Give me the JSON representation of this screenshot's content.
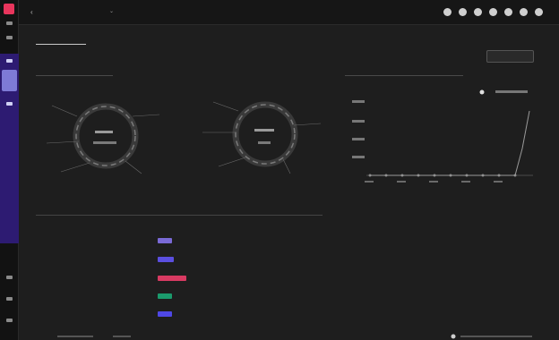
{
  "app": {
    "title": "",
    "nav": [
      "",
      "",
      "",
      "",
      ""
    ]
  },
  "tabs": [
    "",
    ""
  ],
  "sub_tabs": [
    "",
    ""
  ],
  "action_button": "",
  "sections": {
    "left_chart_title": "",
    "right_chart_title": "",
    "table_title": ""
  },
  "table": {
    "headers": [
      "",
      "",
      "",
      ""
    ],
    "rows": [
      {
        "label": "",
        "chip_color": "#7a6ad6"
      },
      {
        "label": "",
        "chip_color": "#5b4fe0"
      },
      {
        "label": "",
        "chip_color": "#d83a62"
      },
      {
        "label": "",
        "chip_color": "#1b9a6c"
      },
      {
        "label": "",
        "chip_color": "#4f48e6"
      }
    ]
  },
  "colors": {
    "brand": "#e8355c",
    "rail_accent": "#2d1b72",
    "chip_purple": "#7a6ad6",
    "chip_blue": "#5b4fe0",
    "chip_red": "#d83a62",
    "chip_green": "#1b9a6c"
  },
  "icons": [
    "search-icon",
    "bell-icon",
    "chat-icon",
    "help-icon",
    "grid-icon",
    "settings-icon",
    "user-icon"
  ]
}
